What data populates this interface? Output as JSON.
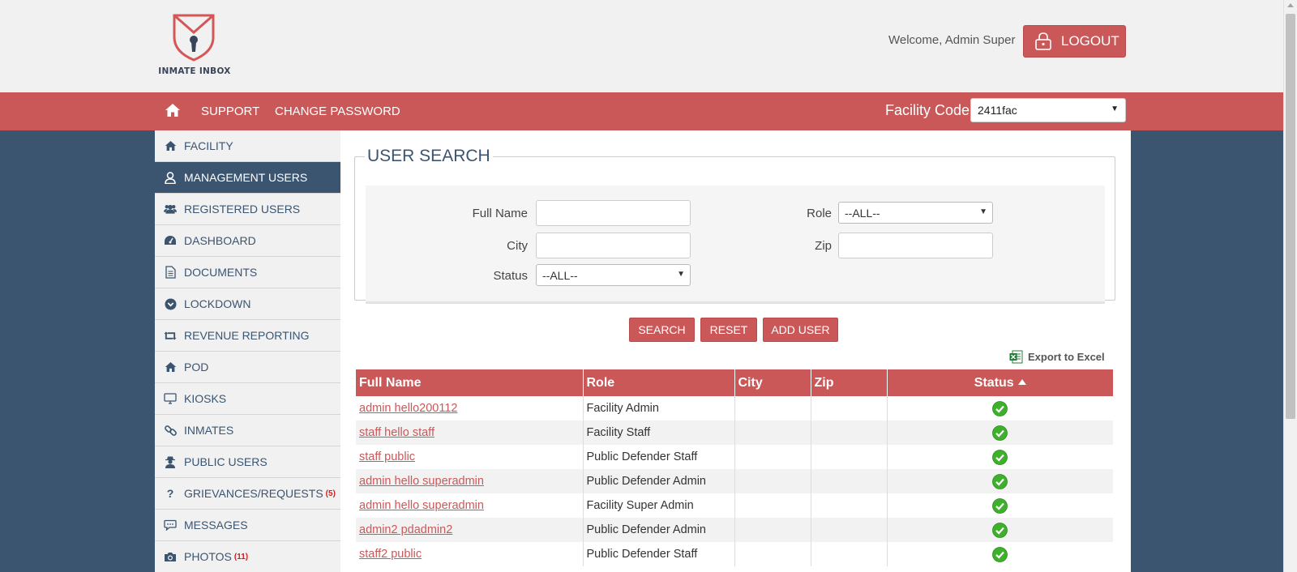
{
  "header": {
    "logo_text": "INMATE INBOX",
    "welcome": "Welcome, Admin Super",
    "logout_label": "LOGOUT"
  },
  "nav": {
    "home_icon": "home-icon",
    "links": [
      "SUPPORT",
      "CHANGE PASSWORD"
    ],
    "facility_label": "Facility Code",
    "facility_value": "2411fac"
  },
  "sidebar": {
    "items": [
      {
        "label": "FACILITY",
        "icon": "home-icon"
      },
      {
        "label": "MANAGEMENT USERS",
        "icon": "user-icon",
        "active": true
      },
      {
        "label": "REGISTERED USERS",
        "icon": "users-icon"
      },
      {
        "label": "DASHBOARD",
        "icon": "dashboard-icon"
      },
      {
        "label": "DOCUMENTS",
        "icon": "document-icon"
      },
      {
        "label": "LOCKDOWN",
        "icon": "chevron-circle-icon"
      },
      {
        "label": "REVENUE REPORTING",
        "icon": "retweet-icon"
      },
      {
        "label": "POD",
        "icon": "home-icon"
      },
      {
        "label": "KIOSKS",
        "icon": "monitor-icon"
      },
      {
        "label": "INMATES",
        "icon": "link-icon"
      },
      {
        "label": "PUBLIC USERS",
        "icon": "user-secret-icon"
      },
      {
        "label": "GRIEVANCES/REQUESTS",
        "icon": "question-icon",
        "badge": "(5)"
      },
      {
        "label": "MESSAGES",
        "icon": "comments-icon"
      },
      {
        "label": "PHOTOS",
        "icon": "camera-icon",
        "badge": "(11)"
      }
    ]
  },
  "search": {
    "legend": "USER SEARCH",
    "full_name_label": "Full Name",
    "city_label": "City",
    "status_label": "Status",
    "status_value": "--ALL--",
    "role_label": "Role",
    "role_value": "--ALL--",
    "zip_label": "Zip"
  },
  "buttons": {
    "search": "SEARCH",
    "reset": "RESET",
    "add_user": "ADD USER"
  },
  "export_label": "Export to Excel",
  "table": {
    "columns": [
      "Full Name",
      "Role",
      "City",
      "Zip",
      "Status"
    ],
    "rows": [
      {
        "name": "admin hello200112",
        "role": "Facility Admin",
        "city": "",
        "zip": "",
        "status": "active"
      },
      {
        "name": "staff hello staff",
        "role": "Facility Staff",
        "city": "",
        "zip": "",
        "status": "active"
      },
      {
        "name": "staff public",
        "role": "Public Defender Staff",
        "city": "",
        "zip": "",
        "status": "active"
      },
      {
        "name": "admin hello superadmin",
        "role": "Public Defender Admin",
        "city": "",
        "zip": "",
        "status": "active"
      },
      {
        "name": "admin hello superadmin",
        "role": "Facility Super Admin",
        "city": "",
        "zip": "",
        "status": "active"
      },
      {
        "name": "admin2 pdadmin2",
        "role": "Public Defender Admin",
        "city": "",
        "zip": "",
        "status": "active"
      },
      {
        "name": "staff2 public",
        "role": "Public Defender Staff",
        "city": "",
        "zip": "",
        "status": "active"
      }
    ]
  },
  "colors": {
    "accent": "#cb5858",
    "sidebar_active": "#3b5571",
    "background": "#3b5571"
  }
}
